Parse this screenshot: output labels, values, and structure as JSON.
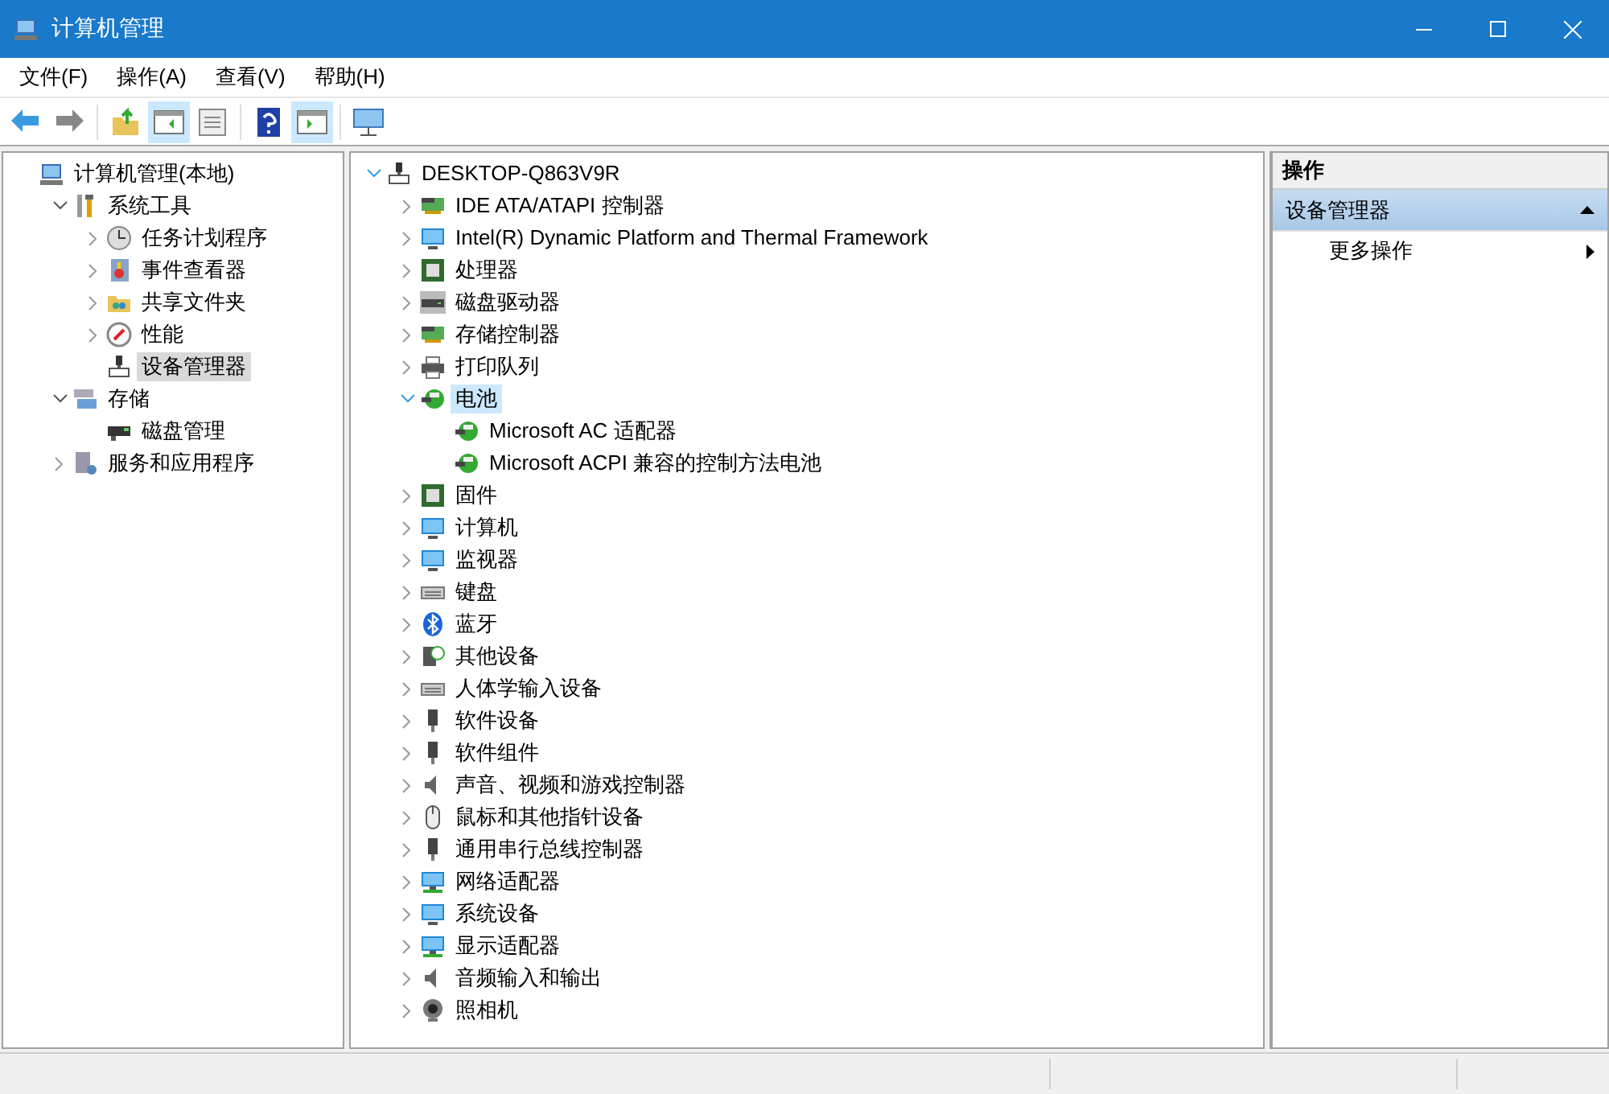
{
  "window": {
    "title": "计算机管理"
  },
  "menu": [
    "文件(F)",
    "操作(A)",
    "查看(V)",
    "帮助(H)"
  ],
  "toolbar": [
    {
      "kind": "back",
      "on": false
    },
    {
      "kind": "forward",
      "on": false
    },
    {
      "kind": "sep"
    },
    {
      "kind": "up",
      "on": false
    },
    {
      "kind": "tree",
      "on": true
    },
    {
      "kind": "export",
      "on": false
    },
    {
      "kind": "sep"
    },
    {
      "kind": "help",
      "on": false
    },
    {
      "kind": "actions",
      "on": true
    },
    {
      "kind": "sep"
    },
    {
      "kind": "monitor",
      "on": false
    }
  ],
  "nav_tree": {
    "focused": false,
    "items": [
      {
        "label": "计算机管理(本地)",
        "kind": "computer",
        "selected": false,
        "children": [
          {
            "label": "系统工具",
            "kind": "tools",
            "expanded": true,
            "selected": false,
            "children": [
              {
                "label": "任务计划程序",
                "kind": "clock",
                "expanded": false,
                "selected": false
              },
              {
                "label": "事件查看器",
                "kind": "log",
                "expanded": false,
                "selected": false
              },
              {
                "label": "共享文件夹",
                "kind": "folder",
                "expanded": false,
                "selected": false
              },
              {
                "label": "性能",
                "kind": "gauge",
                "expanded": false,
                "selected": false
              },
              {
                "label": "设备管理器",
                "kind": "device",
                "selected": true
              }
            ]
          },
          {
            "label": "存储",
            "kind": "storage",
            "expanded": true,
            "selected": false,
            "children": [
              {
                "label": "磁盘管理",
                "kind": "disk",
                "selected": false
              }
            ]
          },
          {
            "label": "服务和应用程序",
            "kind": "services",
            "expanded": false,
            "selected": false
          }
        ]
      }
    ]
  },
  "device_tree": {
    "focused": true,
    "items": [
      {
        "label": "DESKTOP-Q863V9R",
        "kind": "device",
        "expanded": true,
        "selected": false,
        "children": [
          {
            "label": "IDE ATA/ATAPI 控制器",
            "kind": "card",
            "expanded": false,
            "selected": false
          },
          {
            "label": "Intel(R) Dynamic Platform and Thermal Framework",
            "kind": "monitor",
            "expanded": false,
            "selected": false
          },
          {
            "label": "处理器",
            "kind": "chip",
            "expanded": false,
            "selected": false
          },
          {
            "label": "磁盘驱动器",
            "kind": "drive",
            "expanded": false,
            "selected": false
          },
          {
            "label": "存储控制器",
            "kind": "card",
            "expanded": false,
            "selected": false
          },
          {
            "label": "打印队列",
            "kind": "printer",
            "expanded": false,
            "selected": false
          },
          {
            "label": "电池",
            "kind": "battery",
            "expanded": true,
            "selected": true,
            "children": [
              {
                "label": "Microsoft AC 适配器",
                "kind": "battery",
                "selected": false
              },
              {
                "label": "Microsoft ACPI 兼容的控制方法电池",
                "kind": "battery",
                "selected": false
              }
            ]
          },
          {
            "label": "固件",
            "kind": "chip",
            "expanded": false,
            "selected": false
          },
          {
            "label": "计算机",
            "kind": "monitor",
            "expanded": false,
            "selected": false
          },
          {
            "label": "监视器",
            "kind": "monitor",
            "expanded": false,
            "selected": false
          },
          {
            "label": "键盘",
            "kind": "keyboard",
            "expanded": false,
            "selected": false
          },
          {
            "label": "蓝牙",
            "kind": "bluetooth",
            "expanded": false,
            "selected": false
          },
          {
            "label": "其他设备",
            "kind": "unknown",
            "expanded": false,
            "selected": false
          },
          {
            "label": "人体学输入设备",
            "kind": "keyboard",
            "expanded": false,
            "selected": false
          },
          {
            "label": "软件设备",
            "kind": "usb",
            "expanded": false,
            "selected": false
          },
          {
            "label": "软件组件",
            "kind": "usb",
            "expanded": false,
            "selected": false
          },
          {
            "label": "声音、视频和游戏控制器",
            "kind": "speaker",
            "expanded": false,
            "selected": false
          },
          {
            "label": "鼠标和其他指针设备",
            "kind": "mouse",
            "expanded": false,
            "selected": false
          },
          {
            "label": "通用串行总线控制器",
            "kind": "usb",
            "expanded": false,
            "selected": false
          },
          {
            "label": "网络适配器",
            "kind": "network",
            "expanded": false,
            "selected": false
          },
          {
            "label": "系统设备",
            "kind": "monitor",
            "expanded": false,
            "selected": false
          },
          {
            "label": "显示适配器",
            "kind": "network",
            "expanded": false,
            "selected": false
          },
          {
            "label": "音频输入和输出",
            "kind": "speaker",
            "expanded": false,
            "selected": false
          },
          {
            "label": "照相机",
            "kind": "camera",
            "expanded": false,
            "selected": false
          }
        ]
      }
    ]
  },
  "actions": {
    "title": "操作",
    "section": {
      "label": "设备管理器",
      "expanded": true
    },
    "items": [
      "更多操作"
    ]
  }
}
